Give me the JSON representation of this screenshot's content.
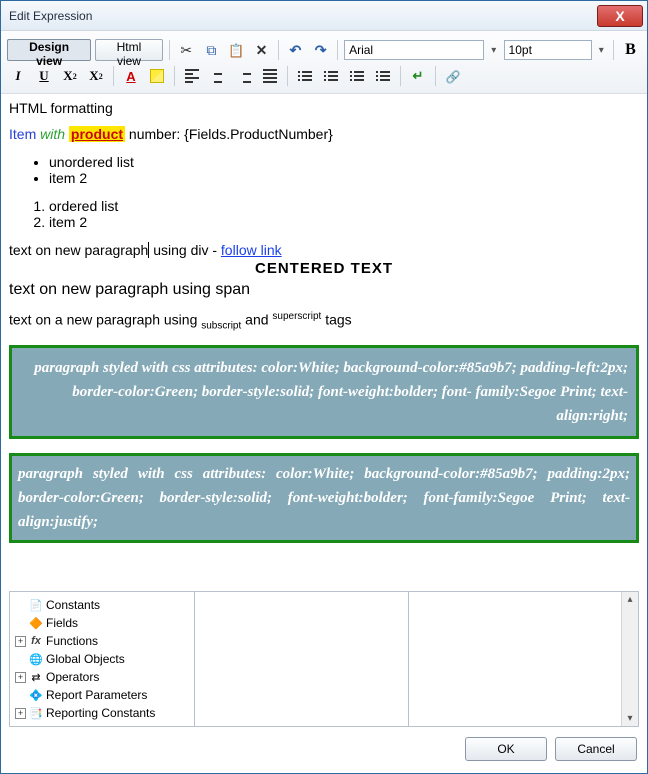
{
  "window": {
    "title": "Edit Expression",
    "close": "X"
  },
  "tabs": {
    "design": "Design view",
    "html": "Html view"
  },
  "toolbar": {
    "font_name": "Arial",
    "font_size": "10pt",
    "bold": "B",
    "italic": "I",
    "underline": "U",
    "sub_x": "X",
    "sub_2": "2",
    "sup_x": "X",
    "sup_2": "2",
    "fcolor": "A"
  },
  "doc": {
    "heading": "HTML formatting",
    "line2": {
      "item": "Item",
      "with": "with",
      "product": "product",
      "rest": " number: {Fields.ProductNumber}"
    },
    "ul": [
      "unordered list",
      "item 2"
    ],
    "ol": [
      "ordered list",
      "item 2"
    ],
    "para_div_a": "text on new paragraph",
    "para_div_b": " using div - ",
    "link_text": "follow link",
    "centered": "CENTERED TEXT",
    "para_span": "text on new paragraph using span",
    "subsup_a": "text on a new paragraph using ",
    "subsup_sub": "subscript",
    "subsup_mid": " and ",
    "subsup_sup": "superscript",
    "subsup_end": " tags",
    "box1": "paragraph styled with css attributes: color:White; background-color:#85a9b7; padding-left:2px; border-color:Green; border-style:solid; font-weight:bolder; font- family:Segoe Print; text-align:right;",
    "box2": "paragraph styled with css attributes: color:White; background-color:#85a9b7; padding:2px; border-color:Green; border-style:solid; font-weight:bolder; font-family:Segoe Print; text-align:justify;"
  },
  "tree": [
    {
      "exp": "",
      "icon": "📄",
      "label": "Constants"
    },
    {
      "exp": "",
      "icon": "🔶",
      "label": "Fields"
    },
    {
      "exp": "+",
      "icon": "fx",
      "label": "Functions"
    },
    {
      "exp": "",
      "icon": "🌐",
      "label": "Global Objects"
    },
    {
      "exp": "+",
      "icon": "⇄",
      "label": "Operators"
    },
    {
      "exp": "",
      "icon": "💠",
      "label": "Report Parameters"
    },
    {
      "exp": "+",
      "icon": "📑",
      "label": "Reporting Constants"
    }
  ],
  "buttons": {
    "ok": "OK",
    "cancel": "Cancel"
  }
}
